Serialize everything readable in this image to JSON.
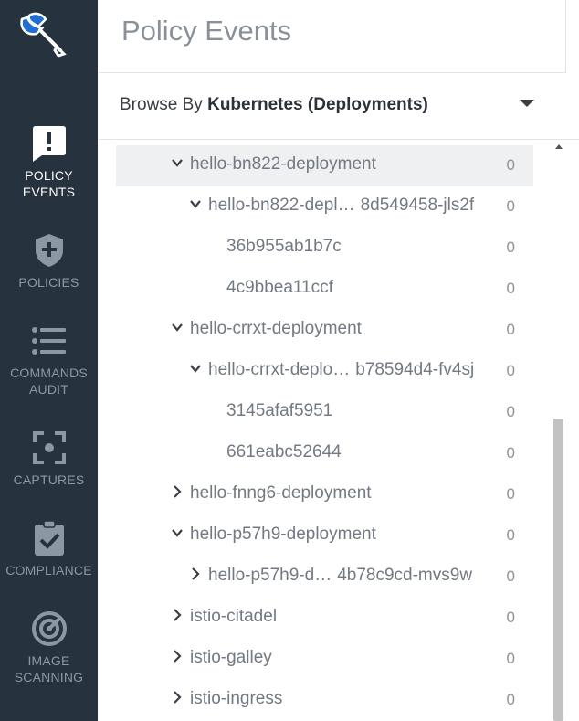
{
  "nav": {
    "items": [
      {
        "label": "POLICY\nEVENTS",
        "icon": "alert-bubble-icon",
        "active": true
      },
      {
        "label": "POLICIES",
        "icon": "shield-plus-icon",
        "active": false
      },
      {
        "label": "COMMANDS\nAUDIT",
        "icon": "list-icon",
        "active": false
      },
      {
        "label": "CAPTURES",
        "icon": "capture-focus-icon",
        "active": false
      },
      {
        "label": "COMPLIANCE",
        "icon": "clipboard-check-icon",
        "active": false
      },
      {
        "label": "IMAGE\nSCANNING",
        "icon": "radar-icon",
        "active": false
      }
    ]
  },
  "header": {
    "title": "Policy Events"
  },
  "browse": {
    "prefix": "Browse By",
    "value": "Kubernetes (Deployments)"
  },
  "tree": {
    "rows": [
      {
        "label": "hello-bn822-deployment",
        "trail": "",
        "count": "0",
        "expanded": true,
        "level": 1,
        "selected": true
      },
      {
        "label": "hello-bn822-depl…",
        "trail": "8d549458-jls2f",
        "count": "0",
        "expanded": true,
        "level": 2,
        "selected": false
      },
      {
        "label": "36b955ab1b7c",
        "trail": "",
        "count": "0",
        "expanded": null,
        "level": 3,
        "selected": false
      },
      {
        "label": "4c9bbea11ccf",
        "trail": "",
        "count": "0",
        "expanded": null,
        "level": 3,
        "selected": false
      },
      {
        "label": "hello-crrxt-deployment",
        "trail": "",
        "count": "0",
        "expanded": true,
        "level": 1,
        "selected": false
      },
      {
        "label": "hello-crrxt-deplo…",
        "trail": "b78594d4-fv4sj",
        "count": "0",
        "expanded": true,
        "level": 2,
        "selected": false
      },
      {
        "label": "3145afaf5951",
        "trail": "",
        "count": "0",
        "expanded": null,
        "level": 3,
        "selected": false
      },
      {
        "label": "661eabc52644",
        "trail": "",
        "count": "0",
        "expanded": null,
        "level": 3,
        "selected": false
      },
      {
        "label": "hello-fnng6-deployment",
        "trail": "",
        "count": "0",
        "expanded": false,
        "level": 1,
        "selected": false
      },
      {
        "label": "hello-p57h9-deployment",
        "trail": "",
        "count": "0",
        "expanded": true,
        "level": 1,
        "selected": false
      },
      {
        "label": "hello-p57h9-d…",
        "trail": "4b78c9cd-mvs9w",
        "count": "0",
        "expanded": false,
        "level": 2,
        "selected": false
      },
      {
        "label": "istio-citadel",
        "trail": "",
        "count": "0",
        "expanded": false,
        "level": 1,
        "selected": false
      },
      {
        "label": "istio-galley",
        "trail": "",
        "count": "0",
        "expanded": false,
        "level": 1,
        "selected": false
      },
      {
        "label": "istio-ingress",
        "trail": "",
        "count": "0",
        "expanded": false,
        "level": 1,
        "selected": false
      }
    ]
  },
  "colors": {
    "sidebar": "#27323f",
    "nav_text": "#8d97a4",
    "nav_active": "#ffffff",
    "tree_text": "#737983"
  }
}
